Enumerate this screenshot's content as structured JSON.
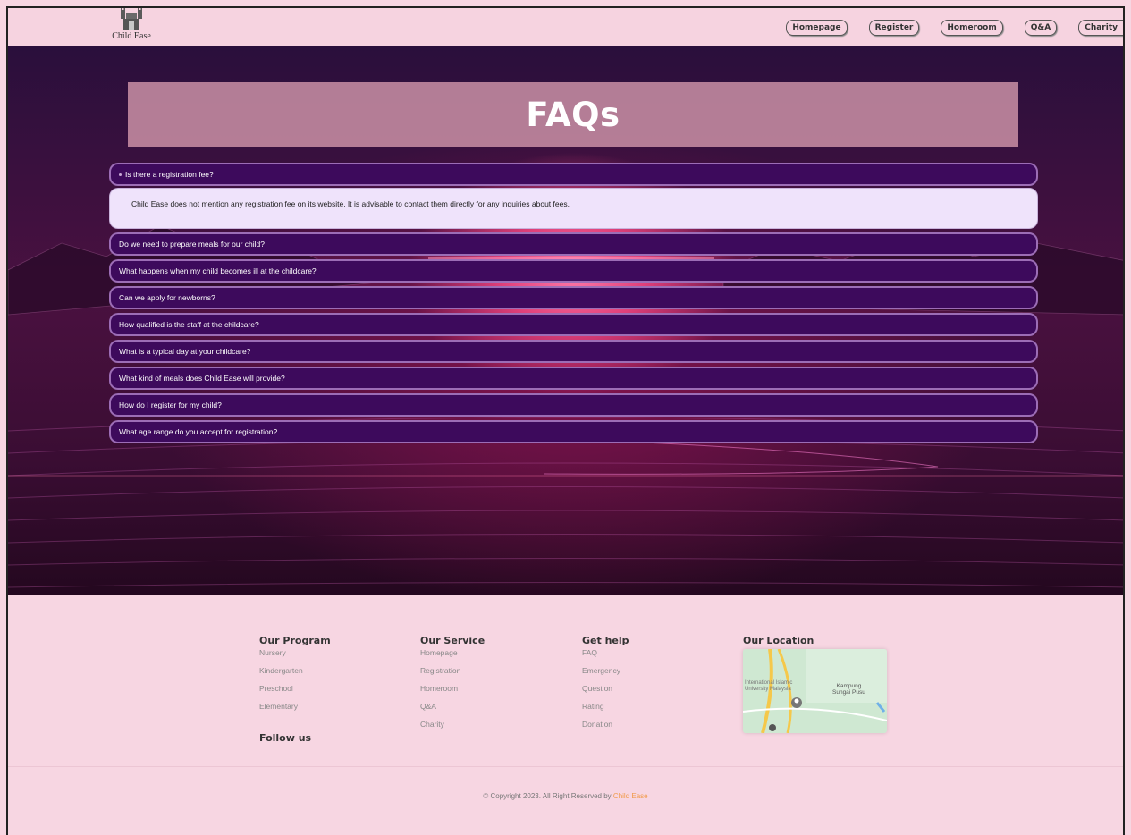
{
  "header": {
    "logo_text": "Child Ease",
    "nav": [
      "Homepage",
      "Register",
      "Homeroom",
      "Q&A",
      "Charity"
    ]
  },
  "faq": {
    "title": "FAQs",
    "open_question": "Is there a registration fee?",
    "open_answer": "Child Ease does not mention any registration fee on its website. It is advisable to contact them directly for any inquiries about fees.",
    "questions": [
      "Do we need to prepare meals for our child?",
      "What happens when my child becomes ill at the childcare?",
      "Can we apply for newborns?",
      "How qualified is the staff at the childcare?",
      "What is a typical day at your childcare?",
      "What kind of meals does Child Ease will provide?",
      "How do I register for my child?",
      "What age range do you accept for registration?"
    ]
  },
  "footer": {
    "program": {
      "title": "Our Program",
      "links": [
        "Nursery",
        "Kindergarten",
        "Preschool",
        "Elementary"
      ]
    },
    "service": {
      "title": "Our Service",
      "links": [
        "Homepage",
        "Registration",
        "Homeroom",
        "Q&A",
        "Charity"
      ]
    },
    "help": {
      "title": "Get help",
      "links": [
        "FAQ",
        "Emergency",
        "Question",
        "Rating",
        "Donation"
      ]
    },
    "location": {
      "title": "Our Location",
      "map_labels": [
        "International Islamic",
        "University Malaysia",
        "Kampung",
        "Sungai Pusu"
      ]
    },
    "follow": "Follow us",
    "copyright": "© Copyright 2023. All Right Reserved by",
    "brand": "Child Ease"
  },
  "colors": {
    "page_bg": "#f7d6e2",
    "question_bg": "#3d0a5c",
    "answer_bg": "#efe3fb",
    "title_box": "#d89cb0",
    "brand_accent": "#f19b4b"
  }
}
